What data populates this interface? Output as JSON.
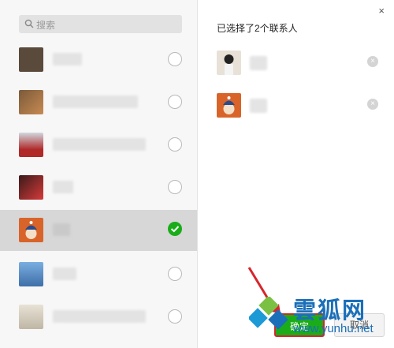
{
  "search": {
    "placeholder": "搜索",
    "icon": "search-icon"
  },
  "contacts": [
    {
      "avatar_color": "#5a4a3c",
      "selected": false
    },
    {
      "avatar_color": "#a0623a",
      "selected": false
    },
    {
      "avatar_color": "#c8d0d8",
      "selected": false
    },
    {
      "avatar_color": "#c0303a",
      "selected": false
    },
    {
      "avatar_color": "#d9642a",
      "selected": true
    },
    {
      "avatar_color": "#6b9acb",
      "selected": false
    },
    {
      "avatar_color": "#d8d2c4",
      "selected": false
    }
  ],
  "right_panel": {
    "title": "已选择了2个联系人",
    "close": "×",
    "selected": [
      {
        "avatar_color": "#e8e1d8"
      },
      {
        "avatar_color": "#d9642a"
      }
    ],
    "remove_glyph": "×"
  },
  "buttons": {
    "confirm": "确定",
    "cancel": "取消"
  },
  "watermark": {
    "text": "雲狐网",
    "url": "www.yunhu.net"
  },
  "colors": {
    "accent": "#1aad19",
    "highlight": "#d6262b",
    "watermark": "#1b6fb8"
  }
}
